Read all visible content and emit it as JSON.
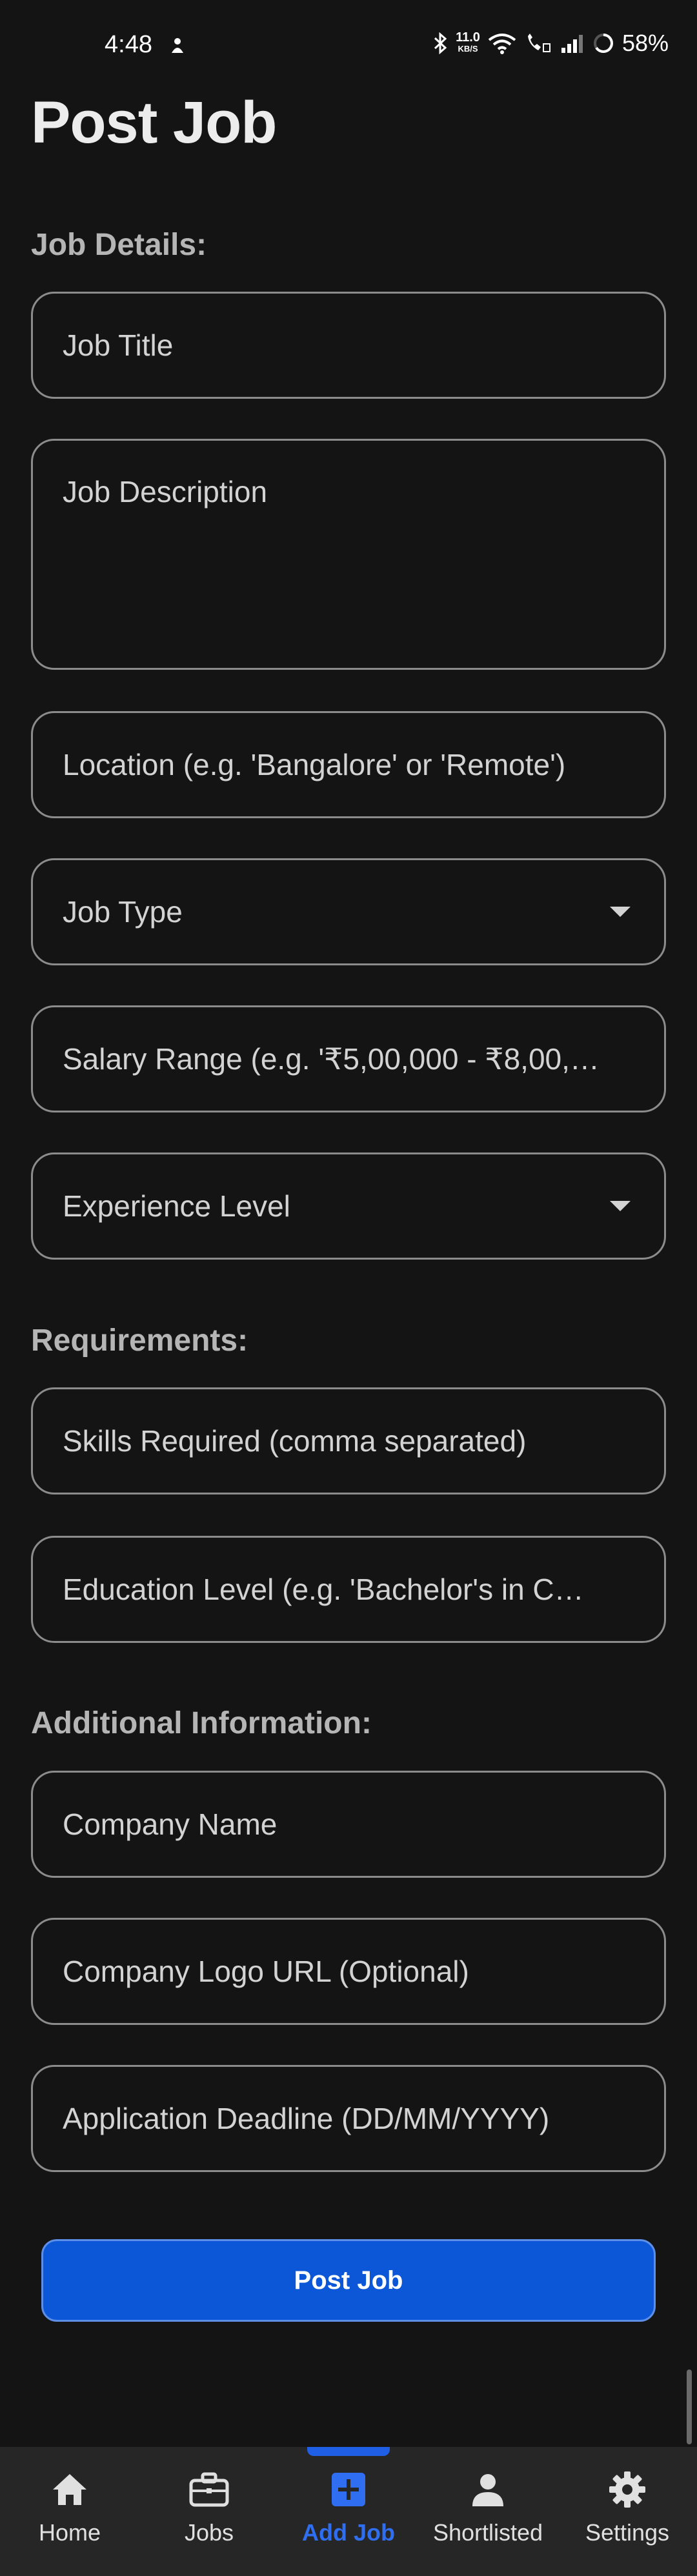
{
  "status_bar": {
    "time": "4:48",
    "speed_value": "11.0",
    "speed_unit": "KB/S",
    "battery": "58%"
  },
  "page": {
    "title": "Post Job"
  },
  "sections": {
    "job_details": "Job Details:",
    "requirements": "Requirements:",
    "additional": "Additional Information:"
  },
  "fields": {
    "job_title": "Job Title",
    "job_description": "Job Description",
    "location": "Location (e.g. 'Bangalore' or 'Remote')",
    "job_type": "Job Type",
    "salary_range": "Salary Range (e.g. '₹5,00,000 - ₹8,00,…",
    "experience_level": "Experience Level",
    "skills": "Skills Required (comma separated)",
    "education": "Education Level (e.g. 'Bachelor's in C…",
    "company_name": "Company Name",
    "company_logo": "Company Logo URL (Optional)",
    "deadline": "Application Deadline (DD/MM/YYYY)"
  },
  "actions": {
    "post_job": "Post Job"
  },
  "bottom_nav": {
    "items": [
      {
        "label": "Home",
        "icon": "home-icon"
      },
      {
        "label": "Jobs",
        "icon": "briefcase-icon"
      },
      {
        "label": "Add Job",
        "icon": "add-box-icon",
        "active": true
      },
      {
        "label": "Shortlisted",
        "icon": "person-icon"
      },
      {
        "label": "Settings",
        "icon": "gear-icon"
      }
    ]
  },
  "colors": {
    "background": "#141414",
    "accent": "#0b57d8",
    "active_nav": "#2f6ef0"
  }
}
